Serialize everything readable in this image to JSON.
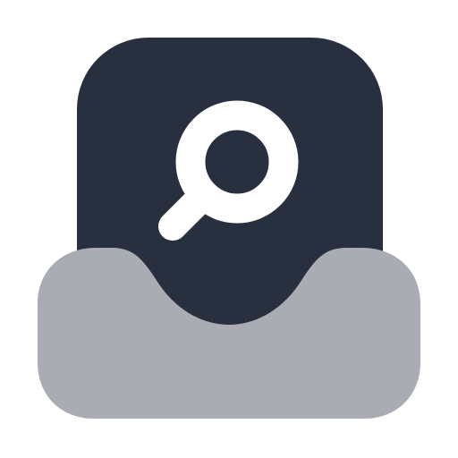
{
  "icon": {
    "semantic": "inbox-search-icon",
    "parts": [
      "document-card",
      "magnifier",
      "tray"
    ]
  },
  "colors": {
    "background": "#ffffff",
    "document": "#282f3f",
    "magnifier": "#ffffff",
    "tray": "#aaacb3"
  }
}
